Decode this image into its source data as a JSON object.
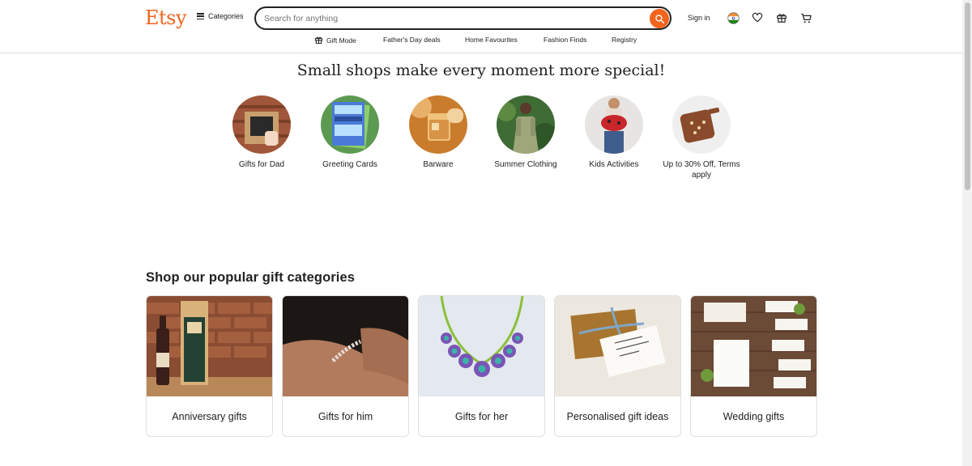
{
  "header": {
    "logo": "Etsy",
    "categories_label": "Categories",
    "search_placeholder": "Search for anything",
    "signin_label": "Sign in"
  },
  "nav": [
    {
      "label": "Gift Mode",
      "icon": "gift-icon"
    },
    {
      "label": "Father's Day deals"
    },
    {
      "label": "Home Favourites"
    },
    {
      "label": "Fashion Finds"
    },
    {
      "label": "Registry"
    }
  ],
  "hero": {
    "title": "Small shops make every moment more special!",
    "items": [
      {
        "label": "Gifts for Dad"
      },
      {
        "label": "Greeting Cards"
      },
      {
        "label": "Barware"
      },
      {
        "label": "Summer Clothing"
      },
      {
        "label": "Kids Activities"
      },
      {
        "label": "Up to 30% Off, Terms apply"
      }
    ]
  },
  "popular": {
    "title": "Shop our popular gift categories",
    "cards": [
      {
        "label": "Anniversary gifts"
      },
      {
        "label": "Gifts for him"
      },
      {
        "label": "Gifts for her"
      },
      {
        "label": "Personalised gift ideas"
      },
      {
        "label": "Wedding gifts"
      }
    ]
  },
  "colors": {
    "brand": "#f1641e",
    "text": "#222222"
  }
}
